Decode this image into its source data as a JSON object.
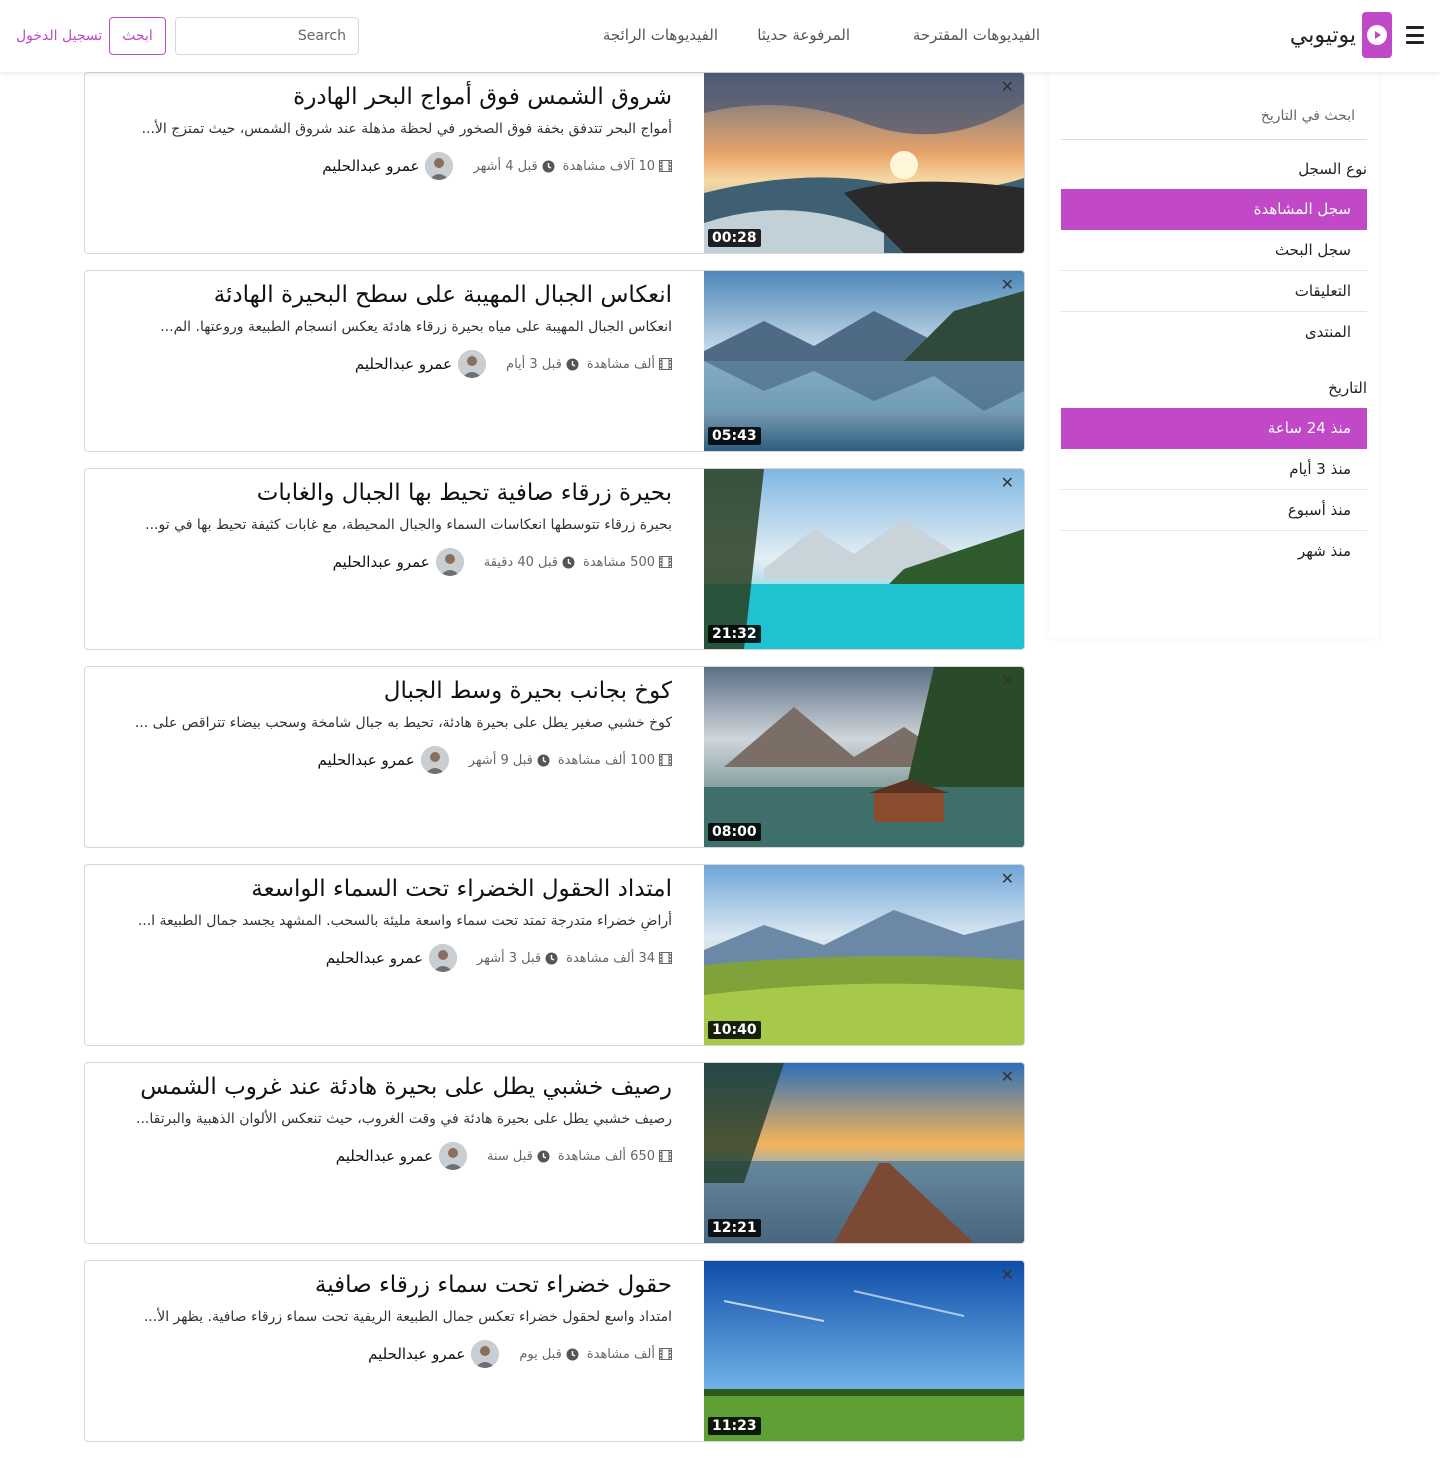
{
  "colors": {
    "accent": "#c148c6",
    "text": "#222222",
    "muted": "#666666"
  },
  "navbar": {
    "brand_name": "يوتيوبي",
    "menu_icon": "hamburger-icon",
    "logo_icon": "play-icon",
    "links": [
      "الفيديوهات المقترحة",
      "المرفوعة حديثا",
      "الفيديوهات الرائجة"
    ],
    "search_placeholder": "Search",
    "search_button": "ابحث",
    "login_link": "تسجيل الدخول"
  },
  "sidebar": {
    "search_placeholder": "ابحث في التاريخ",
    "record_heading": "نوع السجل",
    "record_types": [
      {
        "label": "سجل المشاهدة",
        "active": true
      },
      {
        "label": "سجل البحث",
        "active": false
      },
      {
        "label": "التعليقات",
        "active": false
      },
      {
        "label": "المنتدى",
        "active": false
      }
    ],
    "date_heading": "التاريخ",
    "date_ranges": [
      {
        "label": "منذ 24 ساعة",
        "active": true
      },
      {
        "label": "منذ 3 أيام",
        "active": false
      },
      {
        "label": "منذ أسبوع",
        "active": false
      },
      {
        "label": "منذ شهر",
        "active": false
      }
    ]
  },
  "videos": [
    {
      "title": "شروق الشمس فوق أمواج البحر الهادرة",
      "description": "أمواج البحر تتدفق بخفة فوق الصخور في لحظة مذهلة عند شروق الشمس، حيث تمتزج الأ...",
      "views": "10 آلاف مشاهدة",
      "time_ago": "قبل 4 أشهر",
      "author": "عمرو عبدالحليم",
      "duration": "00:28",
      "scene": "sunrise-sea"
    },
    {
      "title": "انعكاس الجبال المهيبة على سطح البحيرة الهادئة",
      "description": "انعكاس الجبال المهيبة على مياه بحيرة زرقاء هادئة يعكس انسجام الطبيعة وروعتها. الم...",
      "views": "ألف مشاهدة",
      "time_ago": "قبل 3 أيام",
      "author": "عمرو عبدالحليم",
      "duration": "05:43",
      "scene": "mountain-lake"
    },
    {
      "title": "بحيرة زرقاء صافية تحيط بها الجبال والغابات",
      "description": "بحيرة زرقاء تتوسطها انعكاسات السماء والجبال المحيطة، مع غابات كثيفة تحيط بها في تو...",
      "views": "500 مشاهدة",
      "time_ago": "قبل 40 دقيقة",
      "author": "عمرو عبدالحليم",
      "duration": "21:32",
      "scene": "turquoise-lake"
    },
    {
      "title": "كوخ بجانب بحيرة وسط الجبال",
      "description": "كوخ خشبي صغير يطل على بحيرة هادئة، تحيط به جبال شامخة وسحب بيضاء تتراقص على ...",
      "views": "100 ألف مشاهدة",
      "time_ago": "قبل 9 أشهر",
      "author": "عمرو عبدالحليم",
      "duration": "08:00",
      "scene": "cabin-lake"
    },
    {
      "title": "امتداد الحقول الخضراء تحت السماء الواسعة",
      "description": "أراضٍ خضراء متدرجة تمتد تحت سماء واسعة مليئة بالسحب. المشهد يجسد جمال الطبيعة ا...",
      "views": "34 ألف مشاهدة",
      "time_ago": "قبل 3 أشهر",
      "author": "عمرو عبدالحليم",
      "duration": "10:40",
      "scene": "green-fields"
    },
    {
      "title": "رصيف خشبي يطل على بحيرة هادئة عند غروب الشمس",
      "description": "رصيف خشبي يطل على بحيرة هادئة في وقت الغروب، حيث تنعكس الألوان الذهبية والبرتقا...",
      "views": "650 ألف مشاهدة",
      "time_ago": "قبل سنة",
      "author": "عمرو عبدالحليم",
      "duration": "12:21",
      "scene": "sunset-pier"
    },
    {
      "title": "حقول خضراء تحت سماء زرقاء صافية",
      "description": "امتداد واسع لحقول خضراء تعكس جمال الطبيعة الريفية تحت سماء زرقاء صافية. يظهر الأ...",
      "views": "ألف مشاهدة",
      "time_ago": "قبل يوم",
      "author": "عمرو عبدالحليم",
      "duration": "11:23",
      "scene": "blue-sky-field"
    }
  ]
}
